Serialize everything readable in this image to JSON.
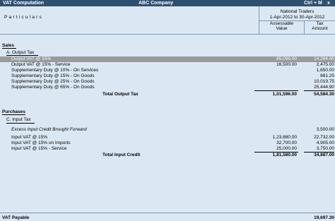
{
  "titlebar": {
    "left": "VAT Computation",
    "center": "ABC Company",
    "right": "Ctrl + M",
    "close": "x"
  },
  "header": {
    "particulars": "Particulars",
    "company": "National Traders",
    "period": "1-Apr-2012 to 30-Apr-2012",
    "col_assessable_1": "Assessable",
    "col_assessable_2": "Value",
    "col_tax_1": "Tax",
    "col_tax_2": "Amount"
  },
  "sales": {
    "title": "Sales",
    "subtitle": "A. Output Tax",
    "rows": [
      {
        "label": "Output VAT @ 15%",
        "value": "85,096.00",
        "tax": "14,264.40"
      },
      {
        "label": "Output VAT @ 15% - Service",
        "value": "16,500.00",
        "tax": "2,475.00"
      },
      {
        "label": "Supplementary Duty @ 10% - On Services",
        "value": "",
        "tax": "1,650.00"
      },
      {
        "label": "Supplementary Duty @ 15% - On Goods",
        "value": "",
        "tax": "881.25"
      },
      {
        "label": "Supplementary Duty @ 25% - On Goods",
        "value": "",
        "tax": "10,019.75"
      },
      {
        "label": "Supplementary Duty @ 65% - On Goods",
        "value": "",
        "tax": "25,444.90"
      }
    ],
    "total_label": "Total Output Tax",
    "total_value": "1,01,596.00",
    "total_tax": "54,584.30"
  },
  "purchases": {
    "title": "Purchases",
    "subtitle": "C. Input Tax",
    "rows": [
      {
        "label": "Excess Input Credit Brought Forward",
        "value": "",
        "tax": "3,500.00",
        "italic": true
      },
      {
        "label": "Input VAT @ 15%",
        "value": "1,23,880.00",
        "tax": "22,732.00"
      },
      {
        "label": "Input VAT @ 15% on Imports",
        "value": "32,700.00",
        "tax": "4,905.00"
      },
      {
        "label": "Input VAT @ 15% - Service",
        "value": "25,000.00",
        "tax": "3,750.00"
      }
    ],
    "total_label": "Total Input Credit",
    "total_value": "1,81,580.00",
    "total_tax": "34,887.00"
  },
  "vat_payable": {
    "label": "VAT Payable",
    "tax": "19,697.30"
  },
  "colors": {
    "background": "#dbe8f4",
    "titlebar": "#2f4f6f",
    "selected_row": "#999a9b"
  }
}
